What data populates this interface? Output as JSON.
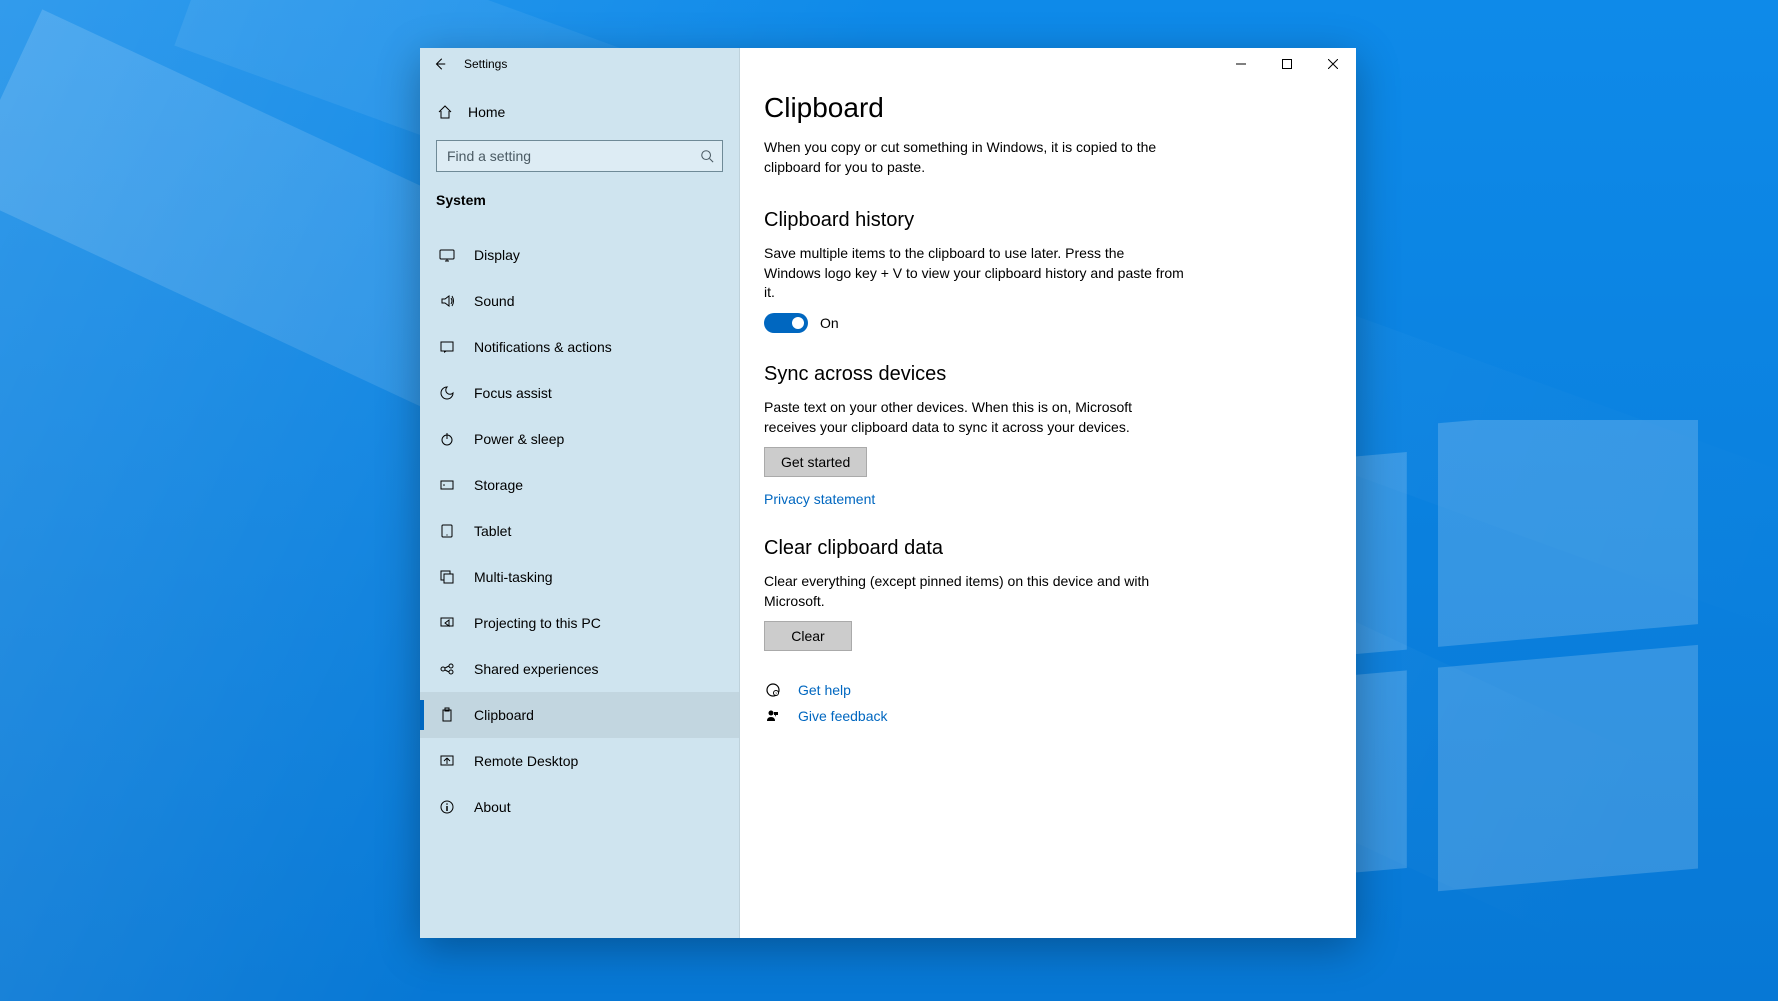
{
  "window": {
    "title": "Settings",
    "home_label": "Home",
    "search_placeholder": "Find a setting",
    "category": "System"
  },
  "nav": {
    "items": [
      {
        "icon": "display",
        "label": "Display"
      },
      {
        "icon": "sound",
        "label": "Sound"
      },
      {
        "icon": "notifications",
        "label": "Notifications & actions"
      },
      {
        "icon": "focus",
        "label": "Focus assist"
      },
      {
        "icon": "power",
        "label": "Power & sleep"
      },
      {
        "icon": "storage",
        "label": "Storage"
      },
      {
        "icon": "tablet",
        "label": "Tablet"
      },
      {
        "icon": "multitasking",
        "label": "Multi-tasking"
      },
      {
        "icon": "projecting",
        "label": "Projecting to this PC"
      },
      {
        "icon": "shared",
        "label": "Shared experiences"
      },
      {
        "icon": "clipboard",
        "label": "Clipboard"
      },
      {
        "icon": "remote",
        "label": "Remote Desktop"
      },
      {
        "icon": "about",
        "label": "About"
      }
    ],
    "active_index": 10
  },
  "page": {
    "title": "Clipboard",
    "intro": "When you copy or cut something in Windows, it is copied to the clipboard for you to paste.",
    "history": {
      "title": "Clipboard history",
      "desc": "Save multiple items to the clipboard to use later. Press the Windows logo key + V to view your clipboard history and paste from it.",
      "toggle_state": "On"
    },
    "sync": {
      "title": "Sync across devices",
      "desc": "Paste text on your other devices. When this is on, Microsoft receives your clipboard data to sync it across your devices.",
      "button": "Get started",
      "privacy_link": "Privacy statement"
    },
    "clear": {
      "title": "Clear clipboard data",
      "desc": "Clear everything (except pinned items) on this device and with Microsoft.",
      "button": "Clear"
    },
    "help": {
      "get_help": "Get help",
      "give_feedback": "Give feedback"
    }
  }
}
